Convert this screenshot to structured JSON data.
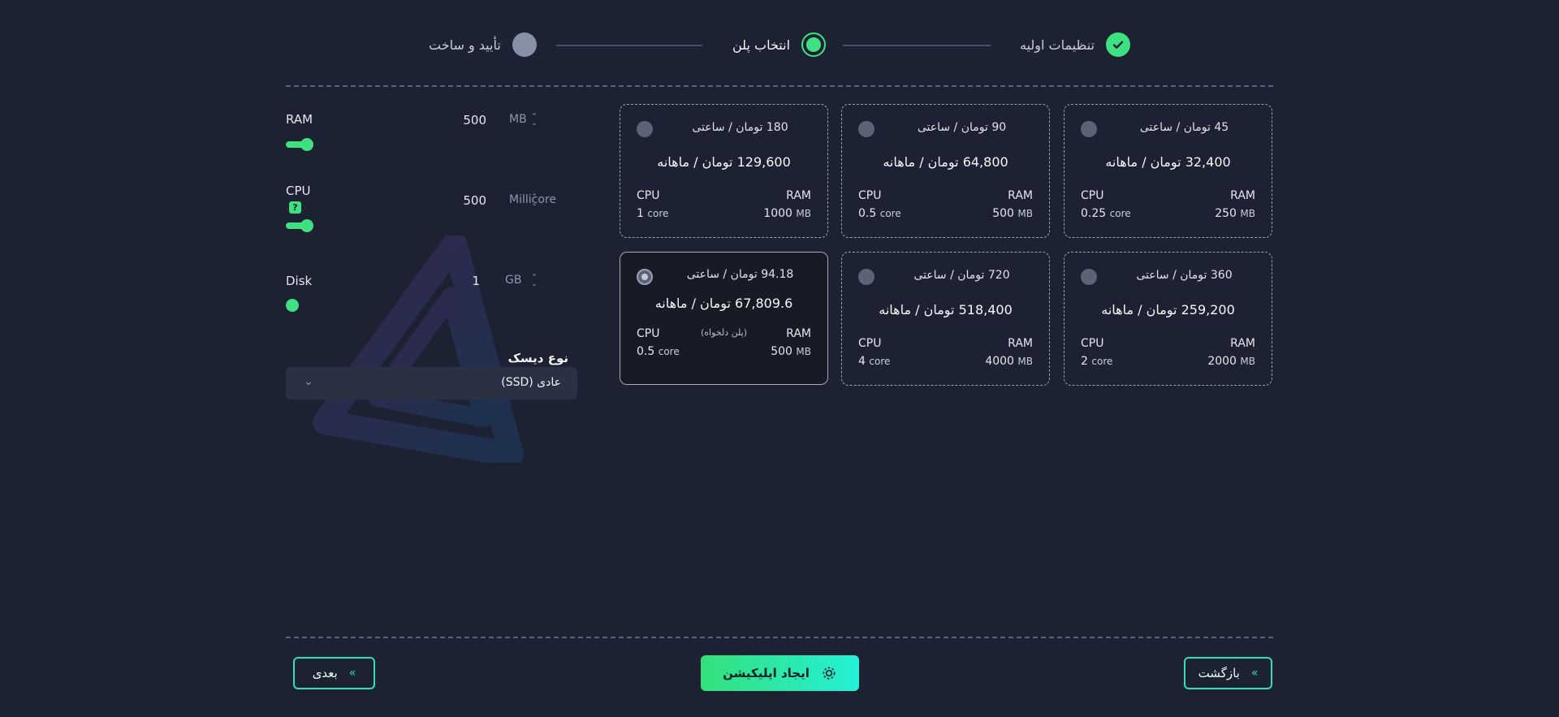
{
  "stepper": {
    "steps": [
      {
        "label": "تنظیمات اولیه",
        "state": "done"
      },
      {
        "label": "انتخاب پلن",
        "state": "current"
      },
      {
        "label": "تأیید و ساخت",
        "state": "pending"
      }
    ]
  },
  "plans": [
    {
      "hourly": "45 تومان / ساعتی",
      "monthly": "32,400 تومان / ماهانه",
      "ram_label": "RAM",
      "ram_value": "250",
      "ram_unit": "MB",
      "cpu_label": "CPU",
      "cpu_value": "0.25",
      "cpu_unit": "core",
      "selected": false
    },
    {
      "hourly": "90 تومان / ساعتی",
      "monthly": "64,800 تومان / ماهانه",
      "ram_label": "RAM",
      "ram_value": "500",
      "ram_unit": "MB",
      "cpu_label": "CPU",
      "cpu_value": "0.5",
      "cpu_unit": "core",
      "selected": false
    },
    {
      "hourly": "180 تومان / ساعتی",
      "monthly": "129,600 تومان / ماهانه",
      "ram_label": "RAM",
      "ram_value": "1000",
      "ram_unit": "MB",
      "cpu_label": "CPU",
      "cpu_value": "1",
      "cpu_unit": "core",
      "selected": false
    },
    {
      "hourly": "360 تومان / ساعتی",
      "monthly": "259,200 تومان / ماهانه",
      "ram_label": "RAM",
      "ram_value": "2000",
      "ram_unit": "MB",
      "cpu_label": "CPU",
      "cpu_value": "2",
      "cpu_unit": "core",
      "selected": false
    },
    {
      "hourly": "720 تومان / ساعتی",
      "monthly": "518,400 تومان / ماهانه",
      "ram_label": "RAM",
      "ram_value": "4000",
      "ram_unit": "MB",
      "cpu_label": "CPU",
      "cpu_value": "4",
      "cpu_unit": "core",
      "selected": false
    },
    {
      "hourly": "94.18 تومان / ساعتی",
      "monthly": "67,809.6 تومان / ماهانه",
      "tag": "(پلن دلخواه)",
      "ram_label": "RAM",
      "ram_value": "500",
      "ram_unit": "MB",
      "cpu_label": "CPU",
      "cpu_value": "0.5",
      "cpu_unit": "core",
      "selected": true
    }
  ],
  "resources": {
    "ram": {
      "label": "RAM",
      "value": "500",
      "unit": "MB",
      "level": 0.06
    },
    "cpu": {
      "label": "CPU",
      "value": "500",
      "unit": "Millicore",
      "help": "?",
      "level": 0.06
    },
    "disk": {
      "label": "Disk",
      "value": "1",
      "unit": "GB",
      "level": 0.0
    }
  },
  "disk_type": {
    "label": "نوع دیسک",
    "value": "عادی (SSD)",
    "chevron": "chevron-down-icon"
  },
  "buttons": {
    "back": "بازگشت",
    "create": "ایجاد اپلیکیشن",
    "next": "بعدی"
  },
  "colors": {
    "accent": "#3ee080",
    "accent2": "#24f0d6",
    "background": "#1d2233"
  }
}
